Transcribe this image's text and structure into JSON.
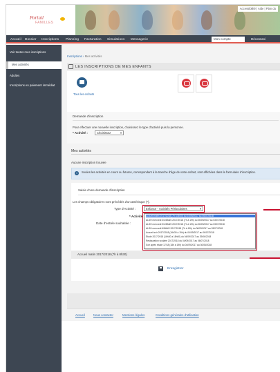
{
  "brand": {
    "line1": "Portail",
    "line2": "FAMILLES"
  },
  "toplinks": "Accessibilité | Aide | Plan du",
  "nav": {
    "items": [
      "Accueil",
      "Dossier",
      "Inscriptions",
      "Planning",
      "Facturation",
      "Simulations",
      "Messagerie"
    ],
    "account": "Mon compte",
    "logout": "Déconnexi"
  },
  "sidebar": {
    "items": [
      "Voir toutes mes inscriptions",
      "Mes activités",
      "Adultes",
      "Inscriptions en paiement immédiat"
    ]
  },
  "breadcrumb": {
    "root": "Inscriptions",
    "sep": "›",
    "current": "Mes activités"
  },
  "section_title": "LES INSCRIPTIONS DE MES ENFANTS",
  "tile_all_label": "Tous les enfants",
  "demand": {
    "title": "Demande d'inscription",
    "desc": "Pour effectuer une nouvelle inscription, choisissez le type d'activité puis la personne.",
    "activity_label": "* Activité :",
    "activity_value": "Choisissez"
  },
  "activities": {
    "title": "Mes activités",
    "none": "Aucune inscription trouvée",
    "info": "Seules les activités en cours ou futures, correspondant à la tranche d'âge de votre enfant, sont affichées dans le formulaire d'inscription."
  },
  "form": {
    "title": "Saisie d'une demande d'inscription",
    "mandatory": "Les champs obligatoires sont précédés d'un astérisque (*).",
    "type_label": "Type d'Activité :",
    "type_value": "Enfance - Activités Périscolaires",
    "activity_label": "* Activité :",
    "date_label": "Date d'entrée souhaitée :",
    "options": [
      "Accueil matin 2017/2018 (7h à 8h30) du 04/09/2017 au 06/07/2018",
      "ALSH mercredi 3/4/5ANS 2017/2018 (7h à 19h) du 06/09/2017 au 03/07/2018",
      "ALSH mercredi 3/4/5ANS 2017/2018 (7h à 19h) du 06/09/2017 au 03/07/2018",
      "ALSH mercredi 6/8ANS 2017/2018 (7h à 19h) du 06/09/2017 au 03/07/2018",
      "Accueil soir 2017/2018 (16h30 à 19h) du 04/09/2017 au 06/07/2018",
      "Étude 2017/2018 (16h30 à 18h00) du 04/09/2017 au 29/06/2018",
      "Restauration scolaire 2017/2018 du 04/09/2017 au 06/07/2018",
      "Soir après étude 17/18 (18h à 19h) du 04/09/2017 au 30/06/2018"
    ],
    "row_label": "Accueil matin 2017/2018 (7h à 8h30)",
    "save": "Enregistrer"
  },
  "footer": {
    "links": [
      "Accueil",
      "Nous contacter",
      "Mentions légales",
      "Conditions générales d'utilisation"
    ]
  },
  "colors": {
    "nav_bg": "#3d4652",
    "accent_red": "#c8102e",
    "link_blue": "#2b6cb0",
    "selection_blue": "#3874d8"
  }
}
